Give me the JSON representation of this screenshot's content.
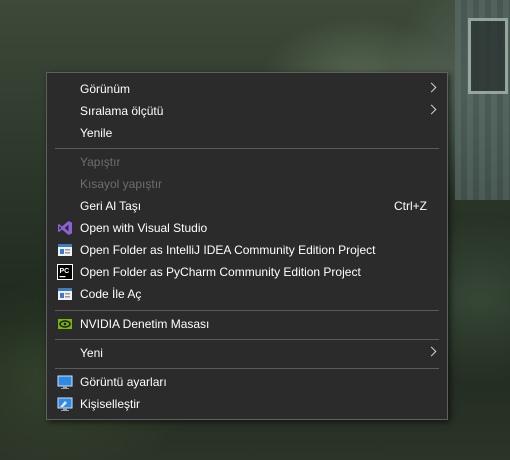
{
  "menu": {
    "items": [
      {
        "label": "Görünüm"
      },
      {
        "label": "Sıralama ölçütü"
      },
      {
        "label": "Yenile"
      },
      {
        "label": "Yapıştır"
      },
      {
        "label": "Kısayol yapıştır"
      },
      {
        "label": "Geri Al Taşı",
        "shortcut": "Ctrl+Z"
      },
      {
        "label": "Open with Visual Studio",
        "icon": "visual-studio-icon"
      },
      {
        "label": "Open Folder as IntelliJ IDEA Community Edition Project",
        "icon": "intellij-icon"
      },
      {
        "label": "Open Folder as PyCharm Community Edition Project",
        "icon": "pycharm-icon"
      },
      {
        "label": "Code İle Aç",
        "icon": "vscode-icon"
      },
      {
        "label": "NVIDIA Denetim Masası",
        "icon": "nvidia-icon"
      },
      {
        "label": "Yeni"
      },
      {
        "label": "Görüntü ayarları",
        "icon": "display-icon"
      },
      {
        "label": "Kişiselleştir",
        "icon": "personalize-icon"
      }
    ]
  }
}
